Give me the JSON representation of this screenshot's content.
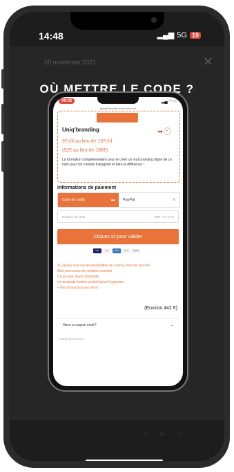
{
  "status_bar": {
    "time": "14:48",
    "network": "5G",
    "battery": "19"
  },
  "story": {
    "date": "28 novembre 2021 ...",
    "title": "OÙ METTRE LE CODE ?"
  },
  "inner_screen": {
    "time": "06:02",
    "url": "graphicmedias.thrivecart.com",
    "offer": {
      "name": "Uniq'branding",
      "price_line1": "97chf au lieu de 197chf",
      "price_line2": "(92€ au lieu de 186€)",
      "description": "La formation complémentaire pour te créer un vrai branding digne de ce nom pour ton compte Instagram et faire la différence !"
    },
    "payment": {
      "heading": "Informations de paiement",
      "tab_card": "Carte de crédit",
      "tab_paypal": "PayPal",
      "card_placeholder": "Numéro de carte",
      "card_expiry": "MM / AA",
      "card_cvc": "CVC",
      "submit_label": "Cliquez ici pour valider",
      "card_logos": [
        "VISA",
        "MC",
        "AMEX",
        "DISC",
        "PayPal"
      ]
    },
    "benefits": [
      "Tu sauras tout sur les possibilités de Canva. Plus de secrets !",
      "Mon processus de création complet",
      "Un groupe Slack d'entraide",
      "Un template Notion exclusif pour t'organiser",
      "+ des bonus tous les mois !"
    ],
    "total": "(Environ 442 €)",
    "coupon_label": "Have a coupon code?",
    "powered_by": "Powered by ThriveCart"
  }
}
